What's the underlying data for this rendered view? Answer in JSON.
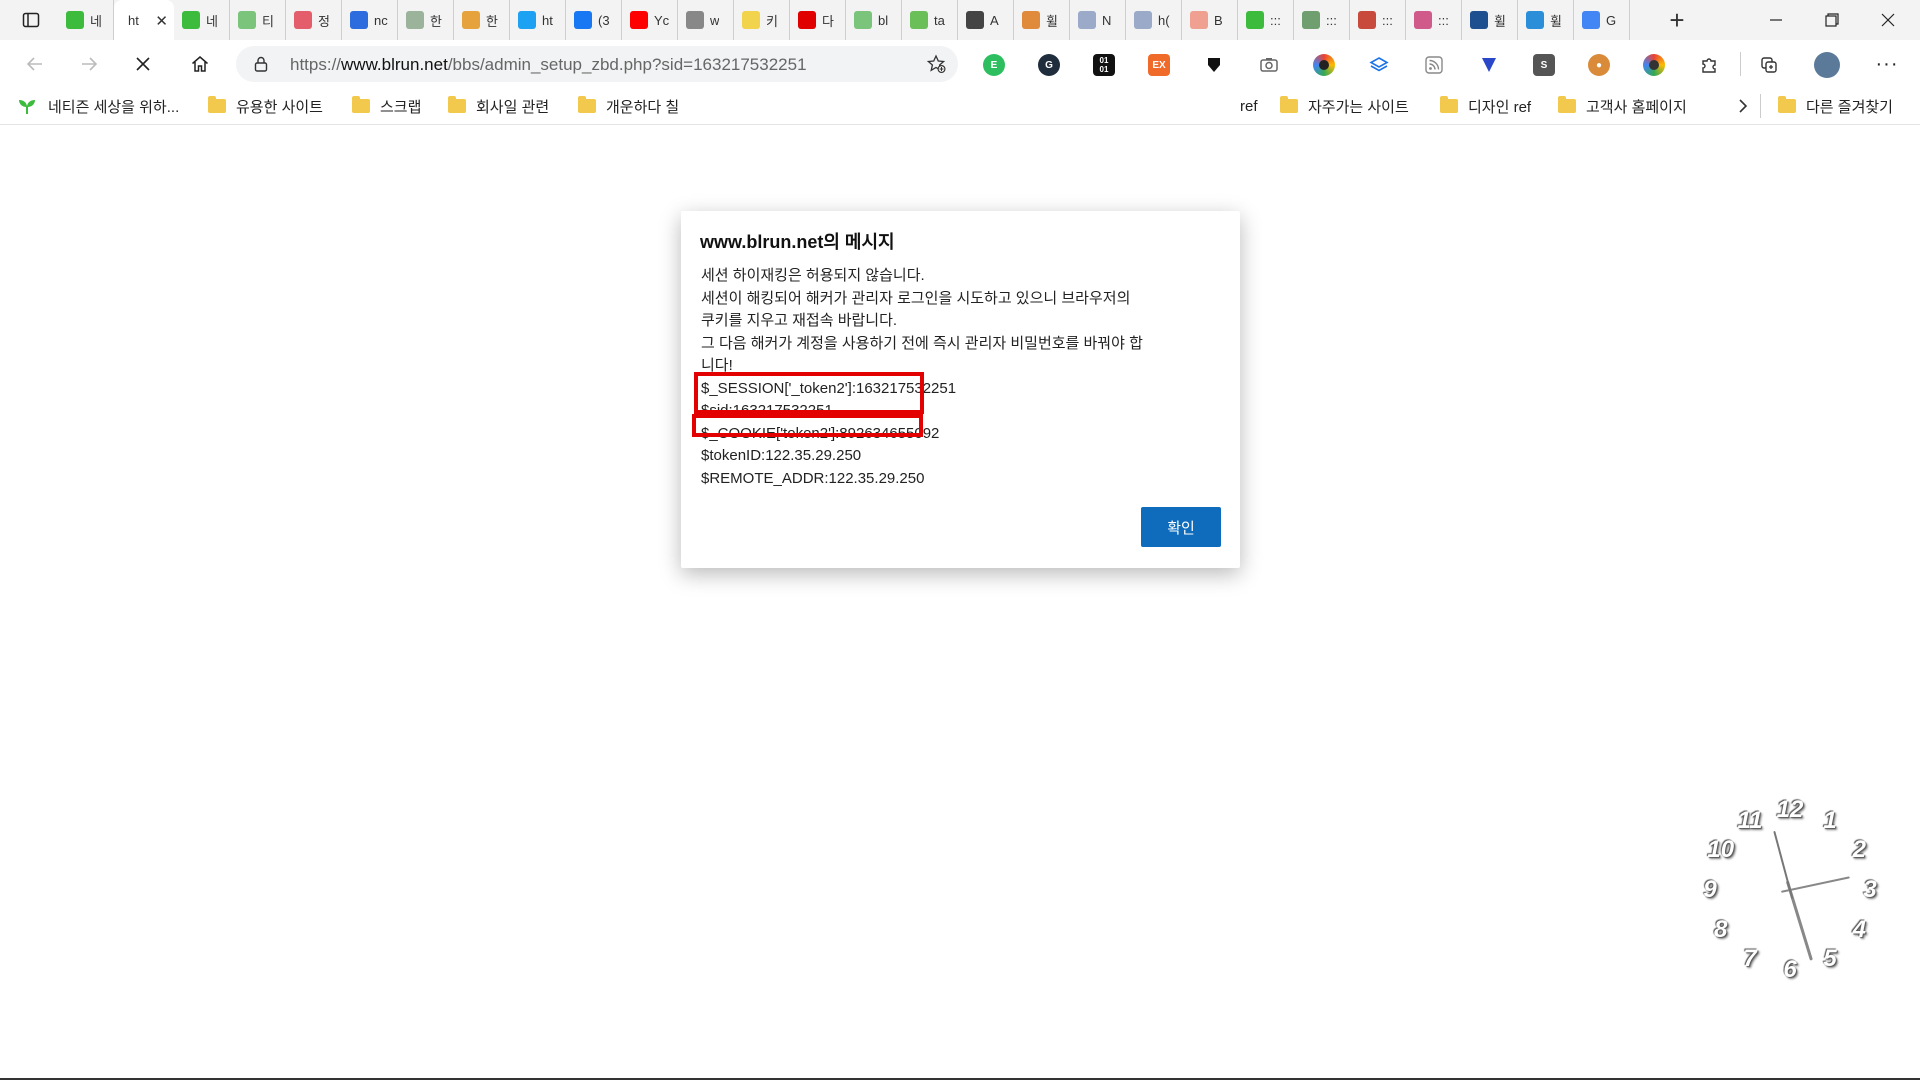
{
  "tabs": [
    {
      "title": "네",
      "fav": "sprout",
      "color": "#3dbb3d"
    },
    {
      "title": "ht",
      "fav": "",
      "color": "",
      "active": true
    },
    {
      "title": "네",
      "fav": "sprout",
      "color": "#3dbb3d"
    },
    {
      "title": "티",
      "fav": "sprout",
      "color": "#7bc47b"
    },
    {
      "title": "정",
      "fav": "n",
      "color": "#e35d6a"
    },
    {
      "title": "nc",
      "fav": "Z",
      "color": "#2d6cdf"
    },
    {
      "title": "한",
      "fav": "person",
      "color": "#9bb39b"
    },
    {
      "title": "한",
      "fav": "figure",
      "color": "#e6a23c"
    },
    {
      "title": "ht",
      "fav": "twitter",
      "color": "#1da1f2"
    },
    {
      "title": "(3",
      "fav": "f",
      "color": "#1877f2"
    },
    {
      "title": "Yc",
      "fav": "yt",
      "color": "#ff0000"
    },
    {
      "title": "w",
      "fav": "ext",
      "color": "#888888"
    },
    {
      "title": "키",
      "fav": "bulb",
      "color": "#f2d34c"
    },
    {
      "title": "다",
      "fav": "red",
      "color": "#e00000"
    },
    {
      "title": "bl",
      "fav": "sprout",
      "color": "#7bc47b"
    },
    {
      "title": "ta",
      "fav": "feather",
      "color": "#6bbf59"
    },
    {
      "title": "A",
      "fav": "a",
      "color": "#444444"
    },
    {
      "title": "휠",
      "fav": "box",
      "color": "#e08a3c"
    },
    {
      "title": "N",
      "fav": "NH",
      "color": "#9aaac8"
    },
    {
      "title": "h(",
      "fav": "NH",
      "color": "#9aaac8"
    },
    {
      "title": "B",
      "fav": "b",
      "color": "#f0a090"
    },
    {
      "title": ":::",
      "fav": "sprout",
      "color": "#3dbb3d"
    },
    {
      "title": ":::",
      "fav": "dots",
      "color": "#6f9f6f"
    },
    {
      "title": ":::",
      "fav": "circle",
      "color": "#c84a3c"
    },
    {
      "title": ":::",
      "fav": "puzzle",
      "color": "#d05a8a"
    },
    {
      "title": "휠",
      "fav": "bars",
      "color": "#1e4f8f"
    },
    {
      "title": "휠",
      "fav": "flag",
      "color": "#2a8fd8"
    },
    {
      "title": "G",
      "fav": "google",
      "color": "#4285f4"
    }
  ],
  "address": {
    "scheme": "https://",
    "host": "www.blrun.net",
    "path": "/bbs/admin_setup_zbd.php?sid=163217532251"
  },
  "bookmarks": {
    "first": "네티즌 세상을 위하...",
    "items": [
      "유용한 사이트",
      "스크랩",
      "회사일 관련",
      "개운하다 칠"
    ],
    "right_partial": "ref",
    "right_items": [
      "자주가는 사이트",
      "디자인 ref",
      "고객사 홈페이지"
    ],
    "other": "다른 즐겨찾기"
  },
  "dialog": {
    "title": "www.blrun.net의 메시지",
    "lines": [
      "세션 하이재킹은 허용되지 않습니다.",
      "세션이 해킹되어 해커가 관리자 로그인을 시도하고 있으니 브라우저의",
      "쿠키를 지우고 재접속 바랍니다.",
      "그 다음 해커가 계정을 사용하기 전에 즉시 관리자 비밀번호를 바꿔야 합",
      "니다!",
      "$_SESSION['_token2']:163217532251",
      "$sid:163217532251",
      "$_COOKIE['token2']:892634655092",
      "$tokenID:122.35.29.250",
      "$REMOTE_ADDR:122.35.29.250"
    ],
    "ok_label": "확인"
  },
  "clock": {
    "numbers": [
      "12",
      "1",
      "2",
      "3",
      "4",
      "5",
      "6",
      "7",
      "8",
      "9",
      "10",
      "11"
    ],
    "hour_angle": 78,
    "minute_angle": 163,
    "second_angle": 345
  },
  "colors": {
    "highlight": "#e20000",
    "button": "#0f6cbd",
    "edge_blue": "#0f6cbd"
  }
}
